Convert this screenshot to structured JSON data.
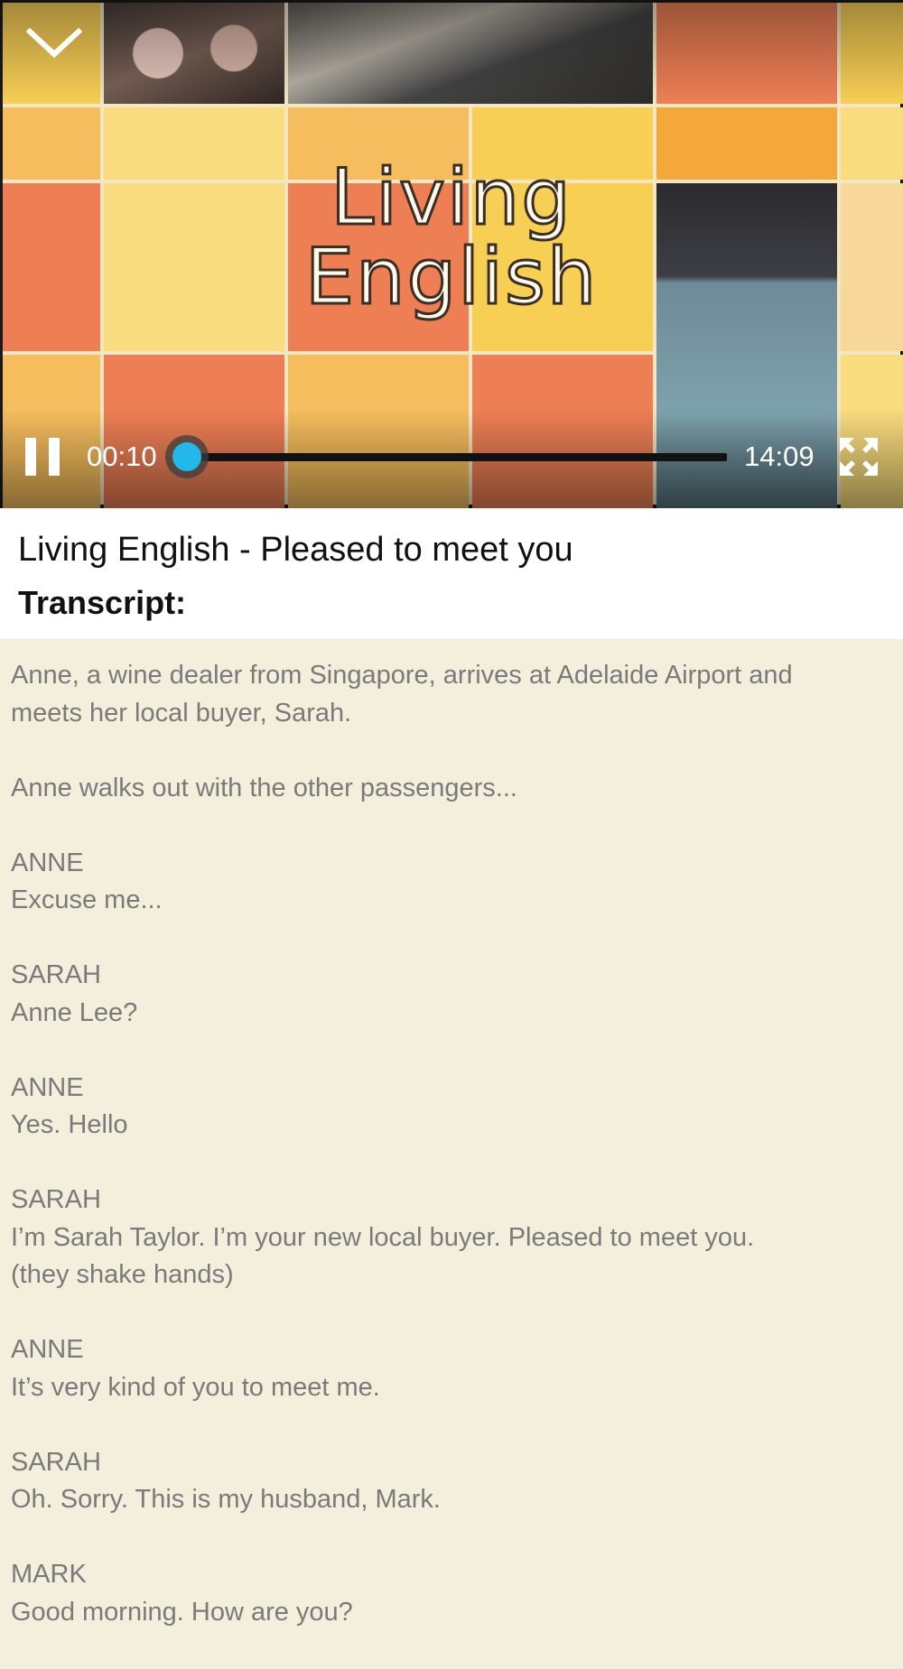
{
  "player": {
    "overlay_text": [
      "Living",
      "English"
    ],
    "current_time": "00:10",
    "total_time": "14:09",
    "progress_fraction": 0.012,
    "accent_color": "#23b7ea",
    "icons": {
      "collapse": "chevron-down-icon",
      "pause": "pause-icon",
      "fullscreen": "fullscreen-icon"
    }
  },
  "header": {
    "title": "Living English - Pleased to meet you",
    "transcript_label": "Transcript:"
  },
  "transcript": [
    {
      "lines": [
        "Anne, a wine dealer from Singapore, arrives at Adelaide Airport and",
        "meets her local buyer, Sarah."
      ]
    },
    {
      "lines": [
        "Anne walks out with the other passengers..."
      ]
    },
    {
      "lines": [
        "ANNE",
        "Excuse me..."
      ]
    },
    {
      "lines": [
        "SARAH",
        "Anne Lee?"
      ]
    },
    {
      "lines": [
        "ANNE",
        "Yes. Hello"
      ]
    },
    {
      "lines": [
        "SARAH",
        "I’m Sarah Taylor. I’m your new local buyer. Pleased to meet you.",
        "(they shake hands)"
      ]
    },
    {
      "lines": [
        "ANNE",
        "It’s very kind of you to meet me."
      ]
    },
    {
      "lines": [
        "SARAH",
        "Oh. Sorry. This is my husband, Mark."
      ]
    },
    {
      "lines": [
        "MARK",
        "Good morning. How are you?"
      ]
    }
  ]
}
